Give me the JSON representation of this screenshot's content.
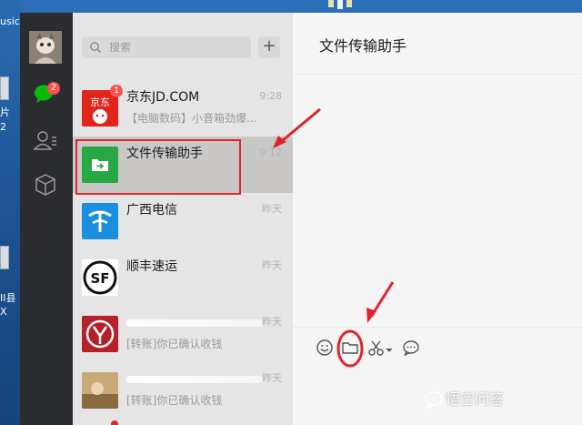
{
  "desktop": {
    "top_label": "usic",
    "side_labels": [
      "片",
      "2",
      "II县",
      "X"
    ]
  },
  "nav": {
    "chat_badge": "2"
  },
  "search": {
    "placeholder": "搜索",
    "add_label": "+"
  },
  "chats": [
    {
      "name": "京东JD.COM",
      "time": "9:28",
      "msg": "【电脑数码】小音箱劲爆...",
      "badge": "1"
    },
    {
      "name": "文件传输助手",
      "time": "9:12",
      "msg": ""
    },
    {
      "name": "广西电信",
      "time": "昨天",
      "msg": ""
    },
    {
      "name": "顺丰速运",
      "time": "昨天",
      "msg": ""
    },
    {
      "name": "",
      "time": "昨天",
      "msg": "[转账]你已确认收钱"
    },
    {
      "name": "",
      "time": "昨天",
      "msg": "[转账]你已确认收钱"
    }
  ],
  "chat_panel": {
    "title": "文件传输助手"
  },
  "watermark": {
    "text": "悟空问答"
  },
  "colors": {
    "nav_bg": "#2b2c30",
    "list_bg": "#e6e5e5",
    "selected_bg": "#c9c8c6",
    "chat_bg": "#f5f5f5",
    "badge": "#fa5151",
    "annotation": "#e0242a",
    "wechat_green": "#09bb07"
  },
  "icons": {
    "nav": [
      "avatar",
      "chat-icon",
      "contacts-icon",
      "favorites-cube-icon"
    ],
    "toolbar": [
      "emoji-icon",
      "folder-icon",
      "scissors-icon",
      "chat-bubble-icon"
    ]
  }
}
